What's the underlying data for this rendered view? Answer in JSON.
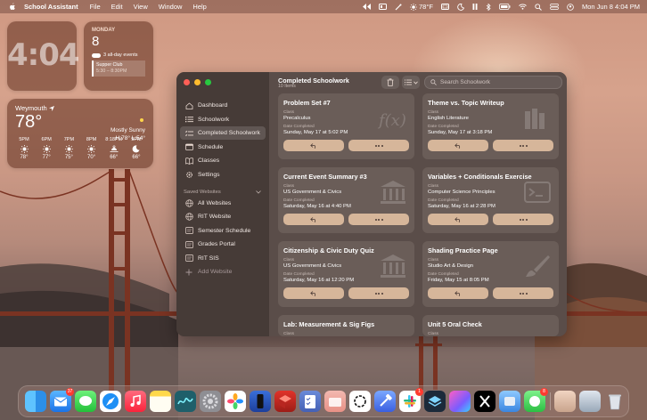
{
  "menubar": {
    "app_name": "School Assistant",
    "menus": [
      "File",
      "Edit",
      "View",
      "Window",
      "Help"
    ],
    "weather": "78°F",
    "datetime": "Mon Jun 8  4:04 PM"
  },
  "widgets": {
    "clock": {
      "time": "4:04"
    },
    "calendar": {
      "weekday": "MONDAY",
      "day": "8",
      "all_day": "3 all-day events",
      "event_title": "Supper Club",
      "event_time": "5:30 – 8:30PM"
    },
    "weather": {
      "location": "Weymouth",
      "temp": "78°",
      "condition": "Mostly Sunny",
      "hilo": "H:78° L:54°",
      "hours": [
        {
          "time": "5PM",
          "icon": "sun-icon",
          "temp": "78°"
        },
        {
          "time": "6PM",
          "icon": "sun-icon",
          "temp": "77°"
        },
        {
          "time": "7PM",
          "icon": "sun-icon",
          "temp": "75°"
        },
        {
          "time": "8PM",
          "icon": "sun-icon",
          "temp": "70°"
        },
        {
          "time": "8:18PM",
          "icon": "sunset-icon",
          "temp": "66°"
        },
        {
          "time": "9PM",
          "icon": "moon-icon",
          "temp": "66°"
        }
      ]
    }
  },
  "sidebar": {
    "items": [
      {
        "label": "Dashboard",
        "icon": "house-icon"
      },
      {
        "label": "Schoolwork",
        "icon": "list-icon"
      },
      {
        "label": "Completed Schoolwork",
        "icon": "checklist-icon"
      },
      {
        "label": "Schedule",
        "icon": "calendar-icon"
      },
      {
        "label": "Classes",
        "icon": "book-icon"
      },
      {
        "label": "Settings",
        "icon": "gear-icon"
      }
    ],
    "saved_header": "Saved Websites",
    "websites": [
      {
        "label": "All Websites",
        "icon": "globe-icon"
      },
      {
        "label": "RIT Website",
        "icon": "globe-icon"
      },
      {
        "label": "Semester Schedule",
        "icon": "document-icon"
      },
      {
        "label": "Grades Portal",
        "icon": "document-icon"
      },
      {
        "label": "RIT SIS",
        "icon": "document-icon"
      }
    ],
    "add_label": "Add Website"
  },
  "toolbar": {
    "title": "Completed Schoolwork",
    "subtitle": "10 Items",
    "search_placeholder": "Search Schoolwork"
  },
  "card_labels": {
    "class": "Class",
    "date": "Date Completed"
  },
  "cards": [
    {
      "title": "Problem Set #7",
      "class": "Precalculus",
      "date": "Sunday, May 17 at 5:02 PM"
    },
    {
      "title": "Theme vs. Topic Writeup",
      "class": "English Literature",
      "date": "Sunday, May 17 at 3:18 PM"
    },
    {
      "title": "Current Event Summary #3",
      "class": "US Government & Civics",
      "date": "Saturday, May 16 at 4:40 PM"
    },
    {
      "title": "Variables + Conditionals Exercise",
      "class": "Computer Science Principles",
      "date": "Saturday, May 16 at 2:28 PM"
    },
    {
      "title": "Citizenship & Civic Duty Quiz",
      "class": "US Government & Civics",
      "date": "Saturday, May 16 at 12:20 PM"
    },
    {
      "title": "Shading Practice Page",
      "class": "Studio Art & Design",
      "date": "Friday, May 15 at 8:05 PM"
    },
    {
      "title": "Lab: Measurement & Sig Figs",
      "class": "",
      "date": ""
    },
    {
      "title": "Unit 5 Oral Check",
      "class": "",
      "date": ""
    }
  ],
  "dock": {
    "badges": {
      "mail": "37",
      "slack": "1",
      "messages2": "8"
    }
  }
}
